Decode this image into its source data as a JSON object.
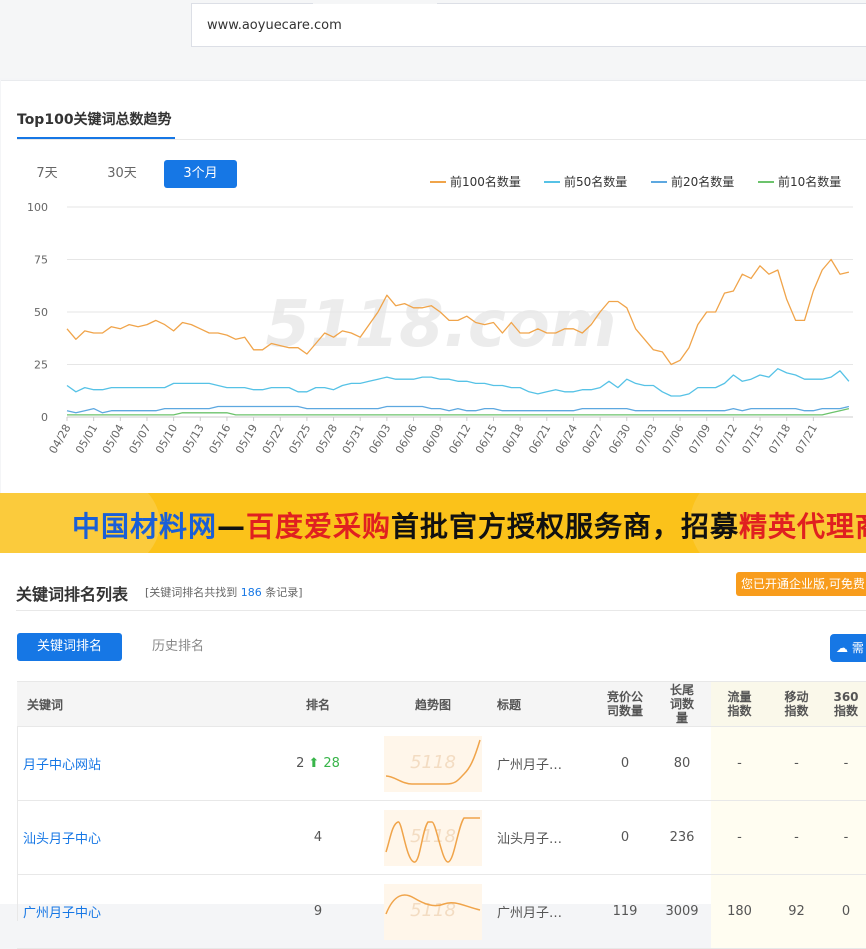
{
  "site_url": "www.aoyuecare.com",
  "trend": {
    "title": "Top100关键词总数趋势",
    "ranges": [
      "7天",
      "30天",
      "3个月"
    ],
    "active_range": "3个月"
  },
  "colors": {
    "accent": "#1677e5",
    "top100": "#f0a44a",
    "top50": "#56c2e6",
    "top20": "#5da8e0",
    "top10": "#6cc36c"
  },
  "chart_data": {
    "type": "line",
    "ylim": [
      0,
      100
    ],
    "yticks": [
      0,
      25,
      50,
      75,
      100
    ],
    "legend_position": "top-right",
    "grid": true,
    "x": [
      "04/28",
      "04/29",
      "04/30",
      "05/01",
      "05/02",
      "05/03",
      "05/04",
      "05/05",
      "05/06",
      "05/07",
      "05/08",
      "05/09",
      "05/10",
      "05/11",
      "05/12",
      "05/13",
      "05/14",
      "05/15",
      "05/16",
      "05/17",
      "05/18",
      "05/19",
      "05/20",
      "05/21",
      "05/22",
      "05/23",
      "05/24",
      "05/25",
      "05/26",
      "05/27",
      "05/28",
      "05/29",
      "05/30",
      "05/31",
      "06/01",
      "06/02",
      "06/03",
      "06/04",
      "06/05",
      "06/06",
      "06/07",
      "06/08",
      "06/09",
      "06/10",
      "06/11",
      "06/12",
      "06/13",
      "06/14",
      "06/15",
      "06/16",
      "06/17",
      "06/18",
      "06/19",
      "06/20",
      "06/21",
      "06/22",
      "06/23",
      "06/24",
      "06/25",
      "06/26",
      "06/27",
      "06/28",
      "06/29",
      "06/30",
      "07/01",
      "07/02",
      "07/03",
      "07/04",
      "07/05",
      "07/06",
      "07/07",
      "07/08",
      "07/09",
      "07/10",
      "07/11",
      "07/12",
      "07/13",
      "07/14",
      "07/15",
      "07/16",
      "07/17",
      "07/18",
      "07/19",
      "07/20",
      "07/21",
      "07/22",
      "07/23",
      "07/24"
    ],
    "xticks": [
      "04/28",
      "05/01",
      "05/04",
      "05/07",
      "05/10",
      "05/13",
      "05/16",
      "05/19",
      "05/22",
      "05/25",
      "05/28",
      "05/31",
      "06/03",
      "06/06",
      "06/09",
      "06/12",
      "06/15",
      "06/18",
      "06/21",
      "06/24",
      "06/27",
      "06/30",
      "07/03",
      "07/06",
      "07/09",
      "07/12",
      "07/15",
      "07/18",
      "07/21"
    ],
    "series": [
      {
        "name": "前100名数量",
        "values": [
          42,
          37,
          41,
          40,
          40,
          43,
          42,
          44,
          43,
          44,
          46,
          44,
          41,
          45,
          44,
          42,
          40,
          40,
          39,
          37,
          38,
          32,
          32,
          35,
          34,
          33,
          33,
          30,
          35,
          40,
          38,
          41,
          40,
          38,
          44,
          50,
          58,
          53,
          54,
          52,
          52,
          53,
          50,
          46,
          46,
          48,
          45,
          44,
          45,
          40,
          45,
          40,
          40,
          42,
          40,
          40,
          42,
          42,
          40,
          44,
          50,
          55,
          55,
          52,
          42,
          37,
          32,
          31,
          25,
          27,
          33,
          44,
          50,
          50,
          59,
          60,
          68,
          66,
          72,
          68,
          70,
          56,
          46,
          46,
          60,
          70,
          75,
          68,
          69
        ]
      },
      {
        "name": "前50名数量",
        "values": [
          15,
          12,
          14,
          13,
          13,
          14,
          14,
          14,
          14,
          14,
          14,
          14,
          16,
          16,
          16,
          16,
          16,
          15,
          14,
          14,
          14,
          13,
          13,
          14,
          14,
          14,
          12,
          12,
          14,
          14,
          13,
          15,
          16,
          16,
          17,
          18,
          19,
          18,
          18,
          18,
          19,
          19,
          18,
          18,
          17,
          17,
          16,
          16,
          15,
          15,
          14,
          14,
          12,
          11,
          12,
          13,
          12,
          12,
          13,
          13,
          14,
          17,
          14,
          18,
          16,
          15,
          15,
          12,
          10,
          10,
          11,
          14,
          14,
          14,
          16,
          20,
          17,
          18,
          20,
          19,
          23,
          21,
          20,
          18,
          18,
          18,
          19,
          22,
          17
        ]
      },
      {
        "name": "前20名数量",
        "values": [
          3,
          2,
          3,
          4,
          2,
          3,
          3,
          3,
          3,
          3,
          3,
          4,
          4,
          4,
          4,
          4,
          4,
          5,
          5,
          5,
          5,
          5,
          5,
          5,
          5,
          5,
          5,
          4,
          4,
          4,
          4,
          4,
          4,
          4,
          4,
          4,
          5,
          5,
          5,
          5,
          5,
          4,
          4,
          3,
          4,
          3,
          3,
          4,
          4,
          3,
          3,
          3,
          3,
          3,
          3,
          3,
          3,
          3,
          4,
          4,
          4,
          4,
          4,
          4,
          3,
          3,
          3,
          3,
          3,
          3,
          3,
          3,
          3,
          3,
          3,
          4,
          3,
          4,
          4,
          4,
          4,
          4,
          4,
          3,
          3,
          4,
          4,
          4,
          5
        ]
      },
      {
        "name": "前10名数量",
        "values": [
          1,
          1,
          1,
          1,
          1,
          1,
          1,
          1,
          1,
          1,
          1,
          1,
          1,
          2,
          2,
          2,
          2,
          2,
          2,
          1,
          1,
          1,
          1,
          1,
          1,
          1,
          1,
          1,
          1,
          1,
          1,
          1,
          1,
          1,
          1,
          1,
          1,
          1,
          1,
          1,
          1,
          1,
          1,
          1,
          1,
          1,
          1,
          1,
          1,
          1,
          1,
          1,
          1,
          1,
          1,
          1,
          1,
          1,
          1,
          1,
          1,
          1,
          1,
          1,
          1,
          1,
          1,
          1,
          1,
          1,
          1,
          1,
          1,
          1,
          1,
          1,
          1,
          1,
          1,
          1,
          1,
          1,
          1,
          1,
          1,
          1,
          2,
          3,
          4
        ]
      }
    ]
  },
  "banner": {
    "part1": "中国材料网",
    "part2": "—",
    "part3": "百度爱采购",
    "part4": "首批官方授权服务商，招募",
    "part5": "精英代理商"
  },
  "list": {
    "title": "关键词排名列表",
    "count_prefix": "[关键词排名共找到",
    "count": "186",
    "count_suffix": "条记录]",
    "notice": "您已开通企业版,可免费",
    "tabs": [
      "关键词排名",
      "历史排名"
    ],
    "export_label": "需",
    "columns": [
      "关键词",
      "排名",
      "趋势图",
      "标题",
      "竞价公司数量",
      "长尾词数量",
      "流量指数",
      "移动指数",
      "360指数"
    ],
    "rows": [
      {
        "keyword": "月子中心网站",
        "rank": "2",
        "change": "28",
        "title": "广州月子…",
        "bid": "0",
        "longtail": "80",
        "traffic": "-",
        "mobile": "-",
        "s360": "-"
      },
      {
        "keyword": "汕头月子中心",
        "rank": "4",
        "change": "",
        "title": "汕头月子…",
        "bid": "0",
        "longtail": "236",
        "traffic": "-",
        "mobile": "-",
        "s360": "-"
      },
      {
        "keyword": "广州月子中心",
        "rank": "9",
        "change": "",
        "title": "广州月子…",
        "bid": "119",
        "longtail": "3009",
        "traffic": "180",
        "mobile": "92",
        "s360": "0"
      }
    ]
  }
}
